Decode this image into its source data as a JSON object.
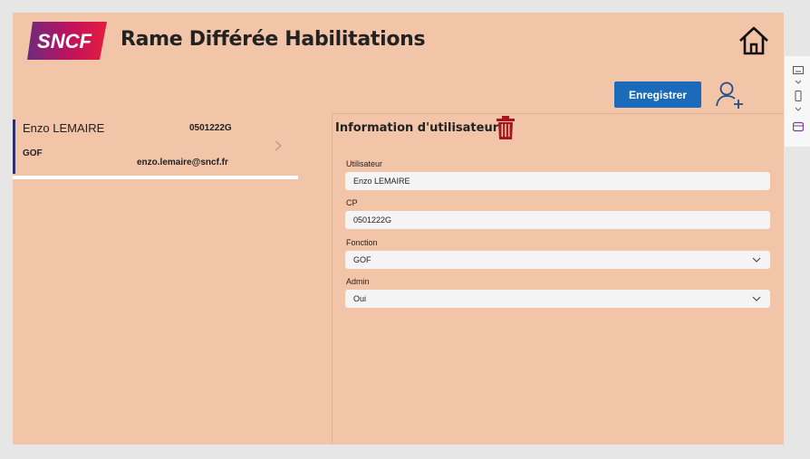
{
  "app": {
    "logo_text": "SNCF",
    "title": "Rame Différée Habilitations"
  },
  "toolbar": {
    "save_label": "Enregistrer"
  },
  "list": {
    "items": [
      {
        "name": "Enzo LEMAIRE",
        "cp": "0501222G",
        "fonction": "GOF",
        "email": "enzo.lemaire@sncf.fr"
      }
    ]
  },
  "form": {
    "title": "Information d'utilisateur",
    "fields": {
      "utilisateur": {
        "label": "Utilisateur",
        "value": "Enzo LEMAIRE"
      },
      "cp": {
        "label": "CP",
        "value": "0501222G"
      },
      "fonction": {
        "label": "Fonction",
        "value": "GOF"
      },
      "admin": {
        "label": "Admin",
        "value": "Oui"
      }
    }
  },
  "colors": {
    "background": "#f2c4a8",
    "accent_button": "#1c6bba",
    "delete_icon": "#a8161b",
    "list_indicator": "#2b2f6e",
    "logo_gradient": [
      "#6e2a7e",
      "#c0125b",
      "#e41e3f"
    ]
  },
  "icons": {
    "home": "home-icon",
    "add_user": "add-user-icon",
    "delete": "trash-icon",
    "chevron": "chevron-right-icon",
    "dropdown": "chevron-down-icon"
  }
}
